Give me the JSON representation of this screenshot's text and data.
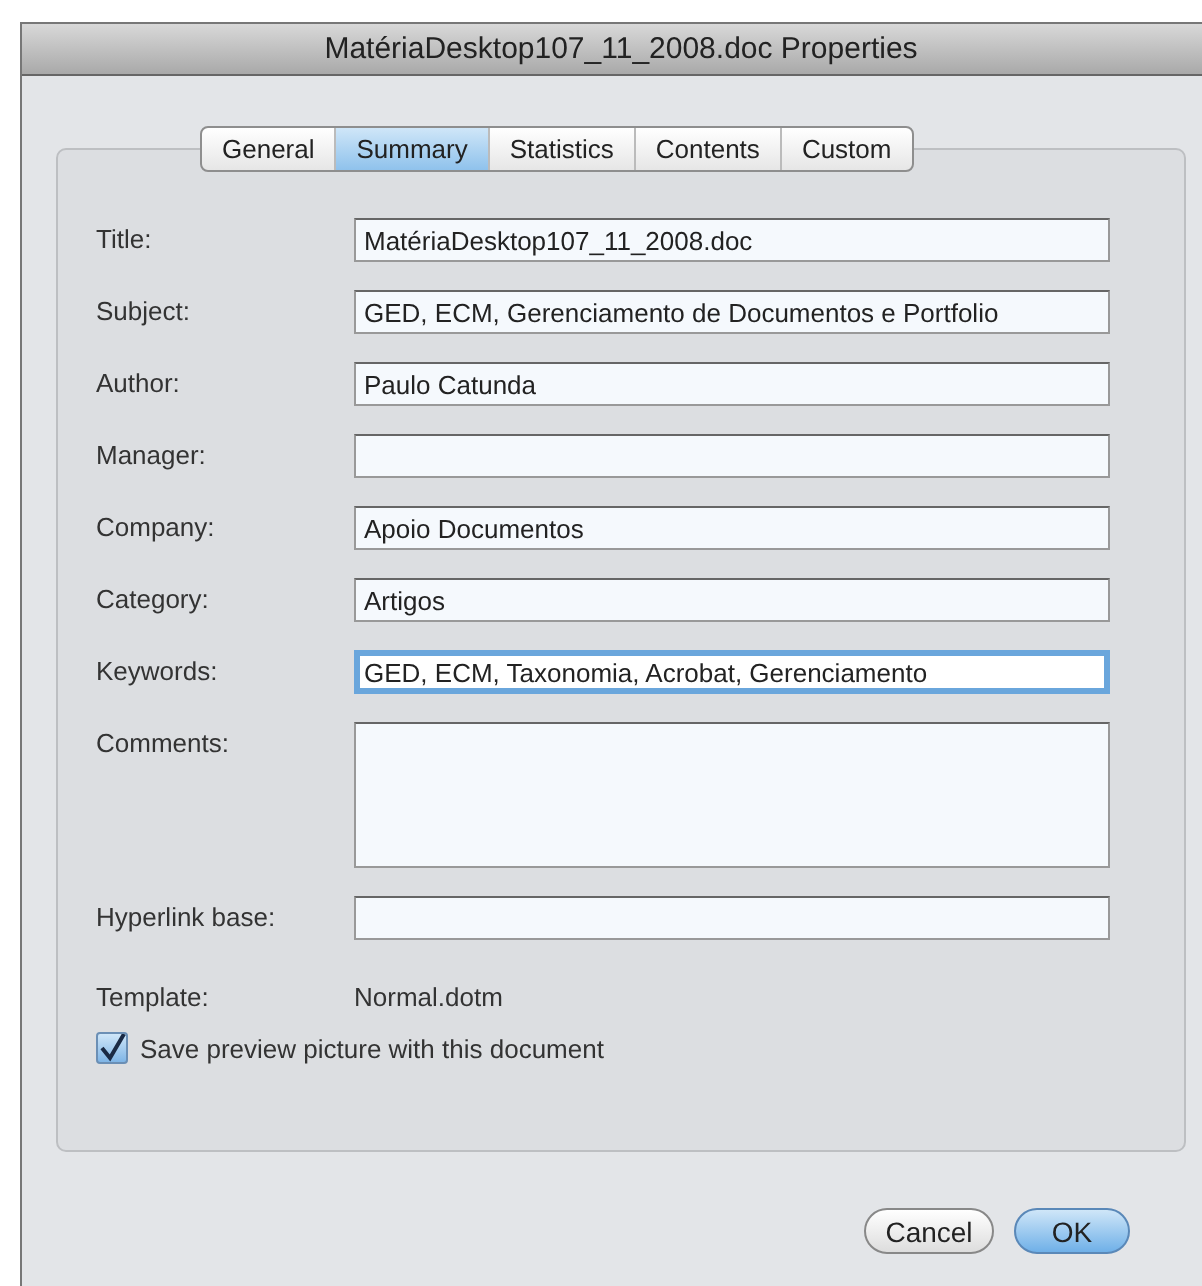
{
  "window": {
    "title": "MatériaDesktop107_11_2008.doc Properties"
  },
  "tabs": [
    {
      "label": "General",
      "selected": false
    },
    {
      "label": "Summary",
      "selected": true
    },
    {
      "label": "Statistics",
      "selected": false
    },
    {
      "label": "Contents",
      "selected": false
    },
    {
      "label": "Custom",
      "selected": false
    }
  ],
  "fields": [
    {
      "label": "Title:",
      "kind": "text",
      "value": "MatériaDesktop107_11_2008.doc",
      "focused": false
    },
    {
      "label": "Subject:",
      "kind": "text",
      "value": "GED, ECM, Gerenciamento de Documentos e Portfolio",
      "focused": false
    },
    {
      "label": "Author:",
      "kind": "text",
      "value": "Paulo Catunda",
      "focused": false
    },
    {
      "label": "Manager:",
      "kind": "text",
      "focused": false
    },
    {
      "label": "Company:",
      "kind": "text",
      "value": "Apoio Documentos",
      "focused": false
    },
    {
      "label": "Category:",
      "kind": "text",
      "value": "Artigos",
      "focused": false
    },
    {
      "label": "Keywords:",
      "kind": "text",
      "value": "GED, ECM, Taxonomia, Acrobat, Gerenciamento",
      "focused": true
    },
    {
      "label": "Comments:",
      "kind": "multiline",
      "focused": false
    },
    {
      "label": "Hyperlink base:",
      "kind": "text",
      "focused": false
    }
  ],
  "template": {
    "label": "Template:",
    "value": "Normal.dotm"
  },
  "save_preview": {
    "label": "Save preview picture with this document",
    "checked": true
  },
  "buttons": [
    {
      "label": "Cancel",
      "kind": "normal"
    },
    {
      "label": "OK",
      "kind": "default"
    }
  ]
}
